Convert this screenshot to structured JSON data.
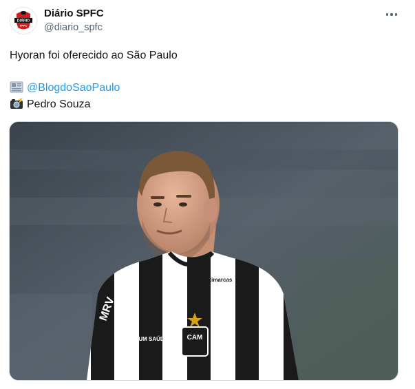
{
  "author": {
    "display_name": "Diário SPFC",
    "handle": "@diario_spfc",
    "avatar_text_top": "DIÁRIO",
    "avatar_text_bottom": "SPFC"
  },
  "tweet": {
    "text": "Hyoran foi oferecido ao São Paulo",
    "source_mention": "@BlogdoSaoPaulo",
    "photo_credit": "Pedro Souza",
    "source_emoji": "newspaper-icon",
    "credit_emoji": "camera-flash-icon"
  },
  "media": {
    "jersey_sponsor_left": "MRV",
    "jersey_sponsor_right": "MRV",
    "jersey_chest_left": "PREMIUM SAÚDE",
    "jersey_crest": "CAM",
    "jersey_shoulder_right": "Multimarcas"
  },
  "colors": {
    "link": "#1d9bf0",
    "secondary_text": "#536471",
    "primary_text": "#0f1419"
  }
}
